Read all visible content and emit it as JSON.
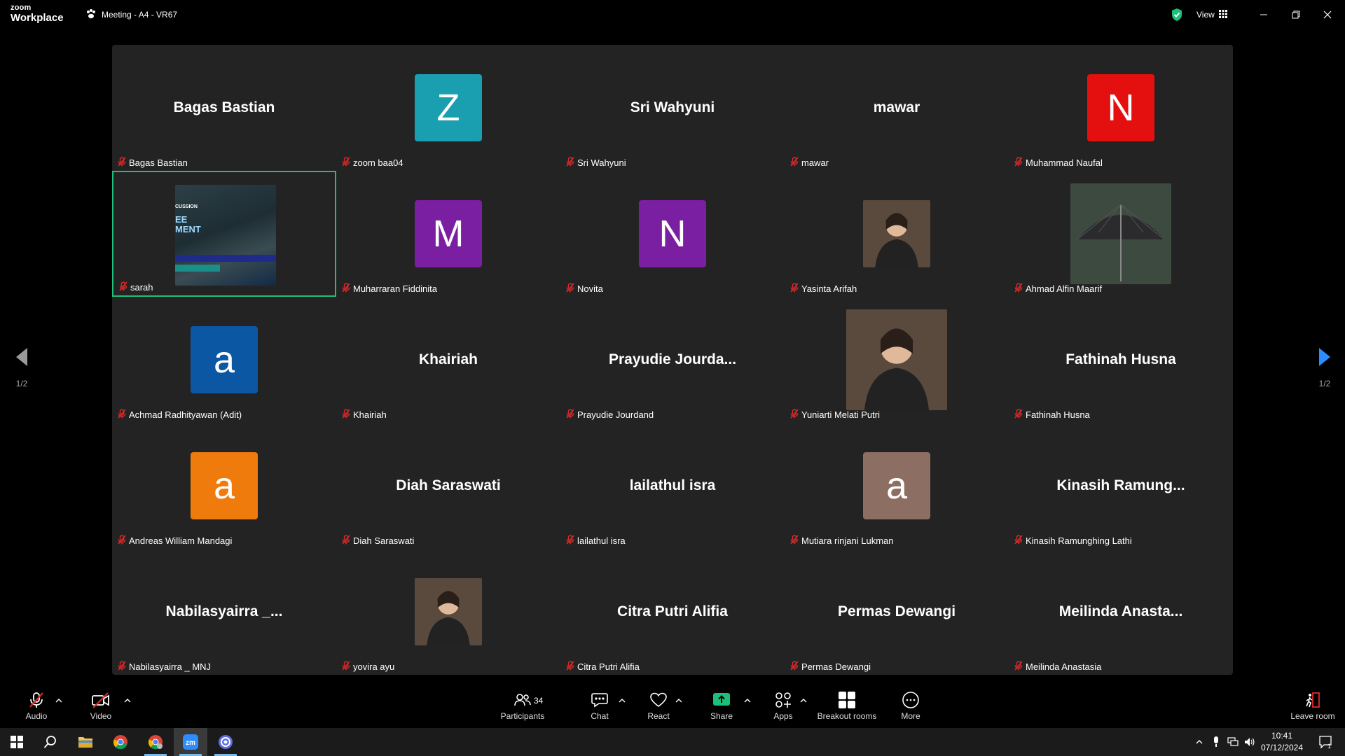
{
  "app": {
    "logo_line1": "zoom",
    "logo_line2": "Workplace",
    "meeting_title": "Meeting - A4 - VR67",
    "view_label": "View"
  },
  "gallery": {
    "page_indicator_left": "1/2",
    "page_indicator_right": "1/2",
    "tiles": [
      {
        "label": "Bagas Bastian",
        "display": "Bagas Bastian"
      },
      {
        "label": "zoom baa04",
        "letter": "Z",
        "color": "#1a9fb0"
      },
      {
        "label": "Sri Wahyuni",
        "display": "Sri Wahyuni"
      },
      {
        "label": "mawar",
        "display": "mawar"
      },
      {
        "label": "Muhammad Naufal",
        "letter": "N",
        "color": "#e3100f"
      },
      {
        "label": "sarah",
        "image": "screen-share-thumbnail",
        "image_text": [
          "CUSSION",
          "EE",
          "MENT"
        ]
      },
      {
        "label": "Muharraran Fiddinita",
        "letter": "M",
        "color": "#7b1fa2"
      },
      {
        "label": "Novita",
        "letter": "N",
        "color": "#7b1fa2"
      },
      {
        "label": "Yasinta Arifah",
        "image": "profile-photo"
      },
      {
        "label": "Ahmad Alfin Maarif",
        "image": "umbrella-photo"
      },
      {
        "label": "Achmad Radhityawan (Adit)",
        "letter": "a",
        "color": "#0b57a4"
      },
      {
        "label": "Khairiah",
        "display": "Khairiah"
      },
      {
        "label": "Prayudie Jourdand",
        "display": "Prayudie  Jourda..."
      },
      {
        "label": "Yuniarti Melati Putri",
        "image": "profile-photo"
      },
      {
        "label": "Fathinah Husna",
        "display": "Fathinah Husna"
      },
      {
        "label": "Andreas William Mandagi",
        "letter": "a",
        "color": "#f07b0d"
      },
      {
        "label": "Diah Saraswati",
        "display": "Diah Saraswati"
      },
      {
        "label": "lailathul isra",
        "display": "lailathul isra"
      },
      {
        "label": "Mutiara rinjani Lukman",
        "letter": "a",
        "color": "#8d6e63"
      },
      {
        "label": "Kinasih Ramunghing Lathi",
        "display": "Kinasih  Ramung..."
      },
      {
        "label": "Nabilasyairra _ MNJ",
        "display": "Nabilasyairra  _..."
      },
      {
        "label": "yovira ayu",
        "image": "profile-photo"
      },
      {
        "label": "Citra Putri Alifia",
        "display": "Citra Putri Alifia"
      },
      {
        "label": "Permas Dewangi",
        "display": "Permas Dewangi"
      },
      {
        "label": "Meilinda Anastasia",
        "display": "Meilinda  Anasta..."
      }
    ]
  },
  "toolbar": {
    "audio": "Audio",
    "video": "Video",
    "participants": "Participants",
    "participant_count": "34",
    "chat": "Chat",
    "react": "React",
    "share": "Share",
    "apps": "Apps",
    "breakout": "Breakout rooms",
    "more": "More",
    "leave": "Leave room"
  },
  "taskbar": {
    "time": "10:41",
    "date": "07/12/2024",
    "notification_count": "1"
  },
  "colors": {
    "active_speaker_border": "#1bc07a",
    "share_green": "#1bc07a",
    "muted_red": "#e02828",
    "nav_arrow_blue": "#2d8cff"
  }
}
